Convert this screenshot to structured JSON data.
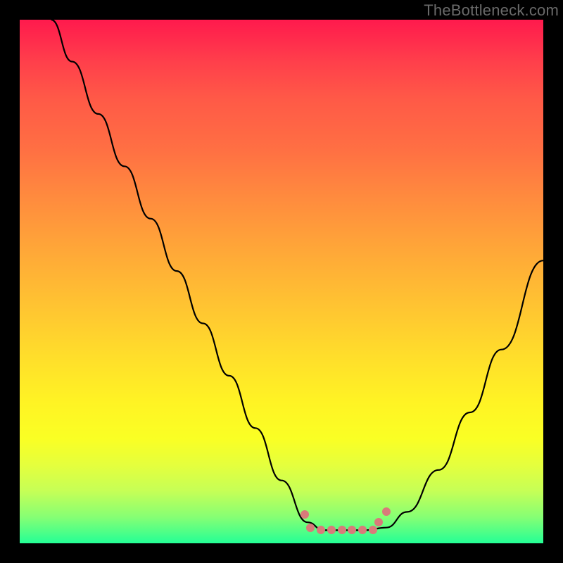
{
  "watermark": "TheBottleneck.com",
  "chart_data": {
    "type": "line",
    "title": "",
    "xlabel": "",
    "ylabel": "",
    "xlim": [
      0,
      1
    ],
    "ylim": [
      0,
      1
    ],
    "series": [
      {
        "name": "bottleneck-curve",
        "x": [
          0.06,
          0.1,
          0.15,
          0.2,
          0.25,
          0.3,
          0.35,
          0.4,
          0.45,
          0.5,
          0.55,
          0.58,
          0.62,
          0.66,
          0.7,
          0.74,
          0.8,
          0.86,
          0.92,
          1.0
        ],
        "y": [
          1.0,
          0.92,
          0.82,
          0.72,
          0.62,
          0.52,
          0.42,
          0.32,
          0.22,
          0.12,
          0.04,
          0.025,
          0.025,
          0.025,
          0.03,
          0.06,
          0.14,
          0.25,
          0.37,
          0.54
        ]
      }
    ],
    "markers": {
      "name": "highlight-dots",
      "color": "#d97a7a",
      "x": [
        0.545,
        0.555,
        0.575,
        0.595,
        0.615,
        0.635,
        0.655,
        0.675,
        0.685,
        0.7
      ],
      "y": [
        0.055,
        0.03,
        0.025,
        0.025,
        0.025,
        0.025,
        0.025,
        0.025,
        0.04,
        0.06
      ]
    }
  }
}
